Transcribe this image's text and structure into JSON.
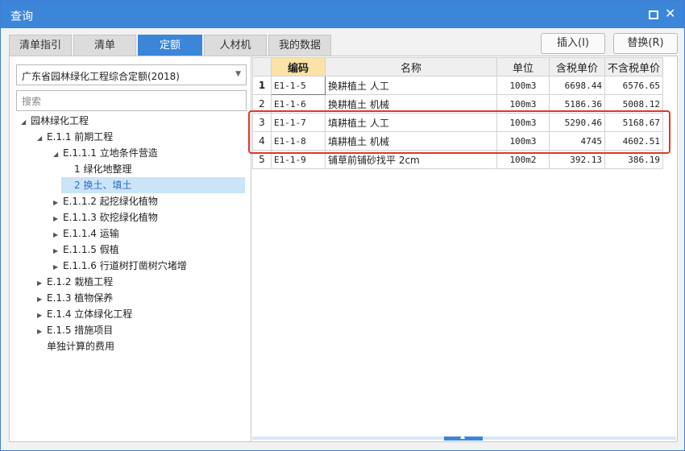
{
  "window": {
    "title": "查询"
  },
  "tabs": [
    "清单指引",
    "清单",
    "定额",
    "人材机",
    "我的数据"
  ],
  "active_tab": "定额",
  "actions": {
    "insert": "插入(I)",
    "replace": "替换(R)"
  },
  "left": {
    "dropdown_value": "广东省园林绿化工程综合定额(2018)",
    "search_placeholder": "搜索",
    "tree": [
      {
        "label": "园林绿化工程",
        "toggle": "◢"
      },
      {
        "label": "E.1.1 前期工程",
        "toggle": "◢"
      },
      {
        "label": "E.1.1.1 立地条件营造",
        "toggle": "◢"
      },
      {
        "label": "1 绿化地整理",
        "toggle": ""
      },
      {
        "label": "2 换土、填土",
        "toggle": ""
      },
      {
        "label": "E.1.1.2 起挖绿化植物",
        "toggle": "▶"
      },
      {
        "label": "E.1.1.3 砍挖绿化植物",
        "toggle": "▶"
      },
      {
        "label": "E.1.1.4 运输",
        "toggle": "▶"
      },
      {
        "label": "E.1.1.5 假植",
        "toggle": "▶"
      },
      {
        "label": "E.1.1.6 行道树打凿树穴堵增",
        "toggle": "▶"
      },
      {
        "label": "E.1.2 栽植工程",
        "toggle": "▶"
      },
      {
        "label": "E.1.3 植物保养",
        "toggle": "▶"
      },
      {
        "label": "E.1.4 立体绿化工程",
        "toggle": "▶"
      },
      {
        "label": "E.1.5 措施项目",
        "toggle": "▶"
      },
      {
        "label": "单独计算的费用",
        "toggle": ""
      }
    ]
  },
  "grid": {
    "headers": [
      "编码",
      "名称",
      "单位",
      "含税单价",
      "不含税单价"
    ],
    "rows": [
      {
        "n": "1",
        "code": "E1-1-5",
        "name": "换耕植土 人工",
        "unit": "100m3",
        "tax": "6698.44",
        "notax": "6576.65"
      },
      {
        "n": "2",
        "code": "E1-1-6",
        "name": "换耕植土 机械",
        "unit": "100m3",
        "tax": "5186.36",
        "notax": "5008.12"
      },
      {
        "n": "3",
        "code": "E1-1-7",
        "name": "填耕植土 人工",
        "unit": "100m3",
        "tax": "5290.46",
        "notax": "5168.67"
      },
      {
        "n": "4",
        "code": "E1-1-8",
        "name": "填耕植土 机械",
        "unit": "100m3",
        "tax": "4745",
        "notax": "4602.51"
      },
      {
        "n": "5",
        "code": "E1-1-9",
        "name": "铺草前铺砂找平 2cm",
        "unit": "100m2",
        "tax": "392.13",
        "notax": "386.19"
      }
    ]
  },
  "colors": {
    "accent": "#3b86d8",
    "highlight": "#e0362c",
    "selected_bg": "#cce4f7"
  }
}
